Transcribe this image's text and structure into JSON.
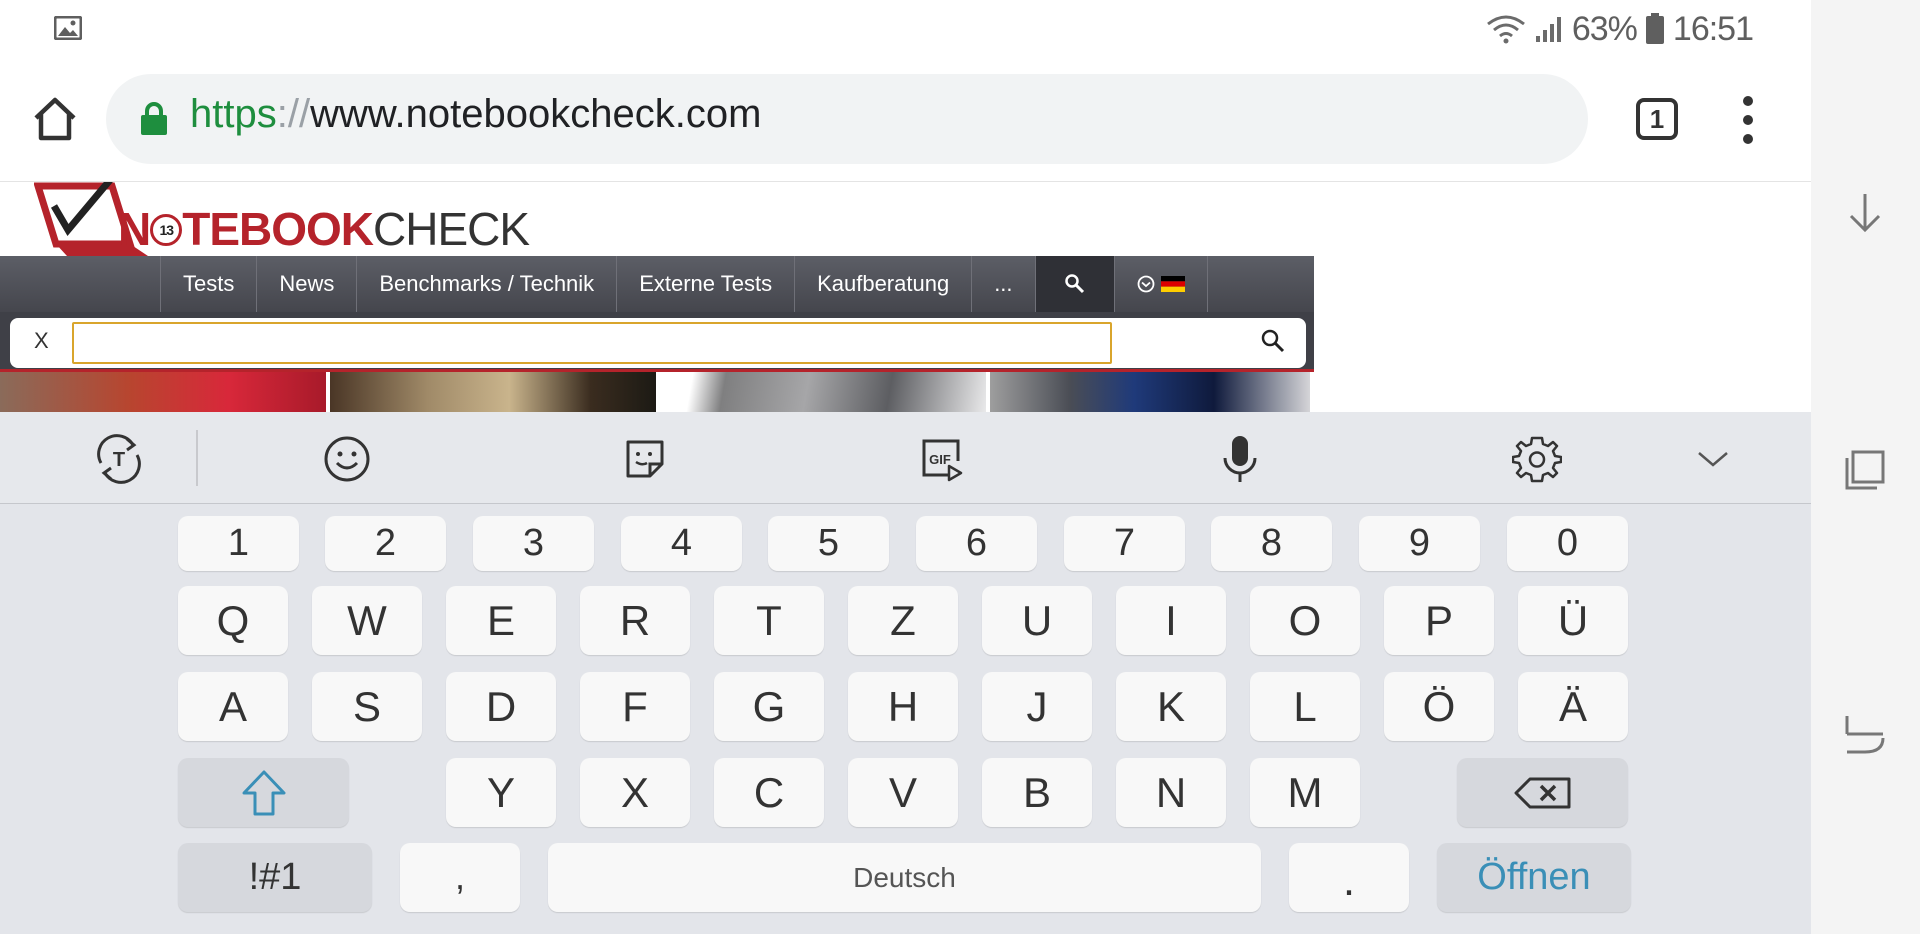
{
  "status_bar": {
    "battery_percent": "63%",
    "time": "16:51",
    "icons": [
      "gallery-icon",
      "wifi-icon",
      "signal-icon",
      "battery-icon"
    ]
  },
  "browser": {
    "url_scheme": "https",
    "url_separator": "://",
    "url_host": "www.notebookcheck.com",
    "tab_count": "1"
  },
  "site": {
    "logo_badge": "13",
    "logo_bold_before": "N",
    "logo_bold_after": "TEBOOK",
    "logo_thin": "CHECK",
    "nav_items": [
      "Tests",
      "News",
      "Benchmarks / Technik",
      "Externe Tests",
      "Kaufberatung",
      "..."
    ],
    "search_close": "X",
    "search_value": ""
  },
  "keyboard": {
    "tools": [
      "text-mode-icon",
      "emoji-icon",
      "sticker-icon",
      "gif-icon",
      "microphone-icon",
      "settings-icon",
      "collapse-icon"
    ],
    "row_numbers": [
      "1",
      "2",
      "3",
      "4",
      "5",
      "6",
      "7",
      "8",
      "9",
      "0"
    ],
    "row_1": [
      "Q",
      "W",
      "E",
      "R",
      "T",
      "Z",
      "U",
      "I",
      "O",
      "P",
      "Ü"
    ],
    "row_2": [
      "A",
      "S",
      "D",
      "F",
      "G",
      "H",
      "J",
      "K",
      "L",
      "Ö",
      "Ä"
    ],
    "row_3": [
      "Y",
      "X",
      "C",
      "V",
      "B",
      "N",
      "M"
    ],
    "symbols_label": "!#1",
    "comma_label": ",",
    "space_label": "Deutsch",
    "period_label": ".",
    "action_label": "Öffnen"
  },
  "colors": {
    "secure_scheme": "#1e8e3e",
    "brand_red": "#b5232b",
    "search_focus": "#d9a52c",
    "keyboard_action": "#3a8fb7"
  }
}
